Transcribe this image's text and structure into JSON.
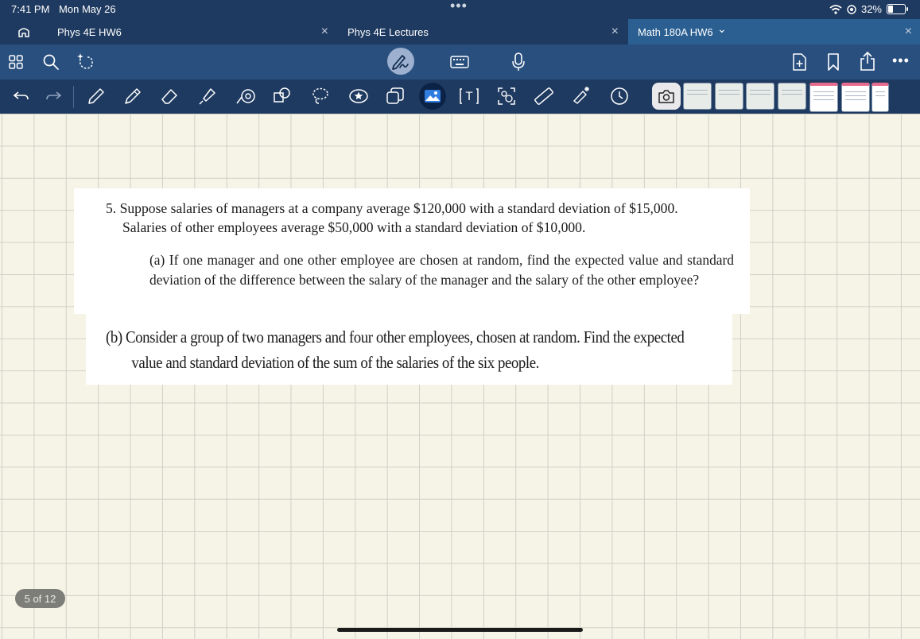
{
  "status": {
    "time": "7:41 PM",
    "date": "Mon May 26",
    "battery": "32%",
    "battery_level": 0.32
  },
  "tabs": [
    {
      "label": "Phys 4E HW6"
    },
    {
      "label": "Phys 4E Lectures"
    },
    {
      "label": "Math 180A HW6"
    }
  ],
  "tab_close": "×",
  "tab_chevron": "⌄",
  "icons": {
    "home": "home-icon",
    "grid": "grid-icon",
    "search": "search-icon",
    "lasso_sparkle": "ai-lasso-icon",
    "pen_mode": "pen-mode-icon",
    "keyboard": "keyboard-icon",
    "mic": "microphone-icon",
    "add_page": "add-page-icon",
    "bookmark": "bookmark-icon",
    "share": "share-icon",
    "more": "more-icon"
  },
  "document": {
    "q5_line1": "5. Suppose salaries of managers at a company average $120,000 with a standard deviation of $15,000.",
    "q5_line2": "Salaries of other employees average $50,000 with a standard deviation of $10,000.",
    "qa_text": "(a) If one manager and one other employee are chosen at random, find the expected value and standard deviation of the difference between the salary of the manager and the salary of the other employee?",
    "qb_line1": "(b) Consider a group of two managers and four other employees, chosen at random. Find the expected",
    "qb_line2": "value and standard deviation of the sum of the salaries of the six people."
  },
  "page_indicator": "5 of 12",
  "colors": {
    "chrome": "#1f3a60",
    "toolbar": "#284f7e",
    "active_tab": "#2b5f91",
    "paper": "#f6f4e6",
    "grid": "#cfd0c8"
  }
}
